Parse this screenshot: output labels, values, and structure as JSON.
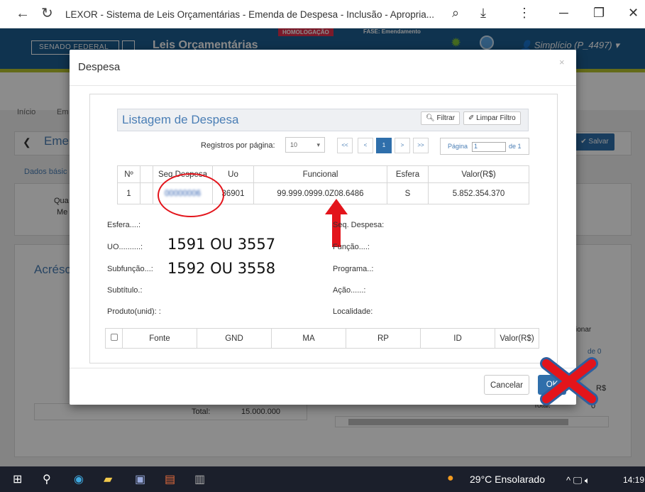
{
  "browser": {
    "tab_title": "LEXOR - Sistema de Leis Orçamentárias - Emenda de Despesa - Inclusão - Apropria..."
  },
  "app": {
    "senado": "SENADO FEDERAL",
    "brand": "Leis Orçamentárias",
    "badge": "HOMOLOGAÇÃO",
    "fase": "FASE: Emendamento",
    "user": "Simplício (P_4497)"
  },
  "page": {
    "inicio": "Início",
    "em": "Em",
    "eme": "Eme",
    "salvar": "Salvar",
    "dados": "Dados básic",
    "qua": "Qua",
    "me": "Me",
    "acres": "Acrésc",
    "total_label": "Total:",
    "total_value": "15.000.000",
    "adicionar": "cionar",
    "de0": "de 0",
    "rs": "R$",
    "total2": "Total:",
    "zero": "0"
  },
  "modal": {
    "title": "Despesa",
    "list_title": "Listagem de Despesa",
    "filtrar": "Filtrar",
    "limpar": "Limpar Filtro",
    "regs_label": "Registros por página:",
    "regs_value": "10",
    "pager": {
      "first": "<<",
      "prev": "<",
      "current": "1",
      "next": ">",
      "last": ">>"
    },
    "pagina_label": "Página",
    "pagina_value": "1",
    "pagina_total": "de 1",
    "columns": [
      "Nº",
      "Seq.Despesa",
      "Uo",
      "Funcional",
      "Esfera",
      "Valor(R$)"
    ],
    "rows": [
      {
        "n": "1",
        "seq": "00000006",
        "uo": "36901",
        "funcional": "99.999.0999.0Z08.6486",
        "esfera": "S",
        "valor": "5.852.354.370"
      }
    ],
    "details": {
      "esfera": "Esfera....:",
      "seq": "Seq. Despesa:",
      "uo": "UO..........:",
      "funcao": "Função....:",
      "subfuncao": "Subfunção...:",
      "programa": "Programa..:",
      "subtitulo": "Subtítulo.:",
      "acao": "Ação......:",
      "produto": "Produto(unid): :",
      "localidade": "Localidade:"
    },
    "annot_uo": "1591 OU 3557",
    "annot_sub": "1592 OU 3558",
    "src_columns": [
      "Fonte",
      "GND",
      "MA",
      "RP",
      "ID",
      "Valor(R$)"
    ],
    "cancel": "Cancelar",
    "ok": "OK"
  },
  "taskbar": {
    "weather": "29°C  Ensolarado",
    "time": "14:19"
  }
}
